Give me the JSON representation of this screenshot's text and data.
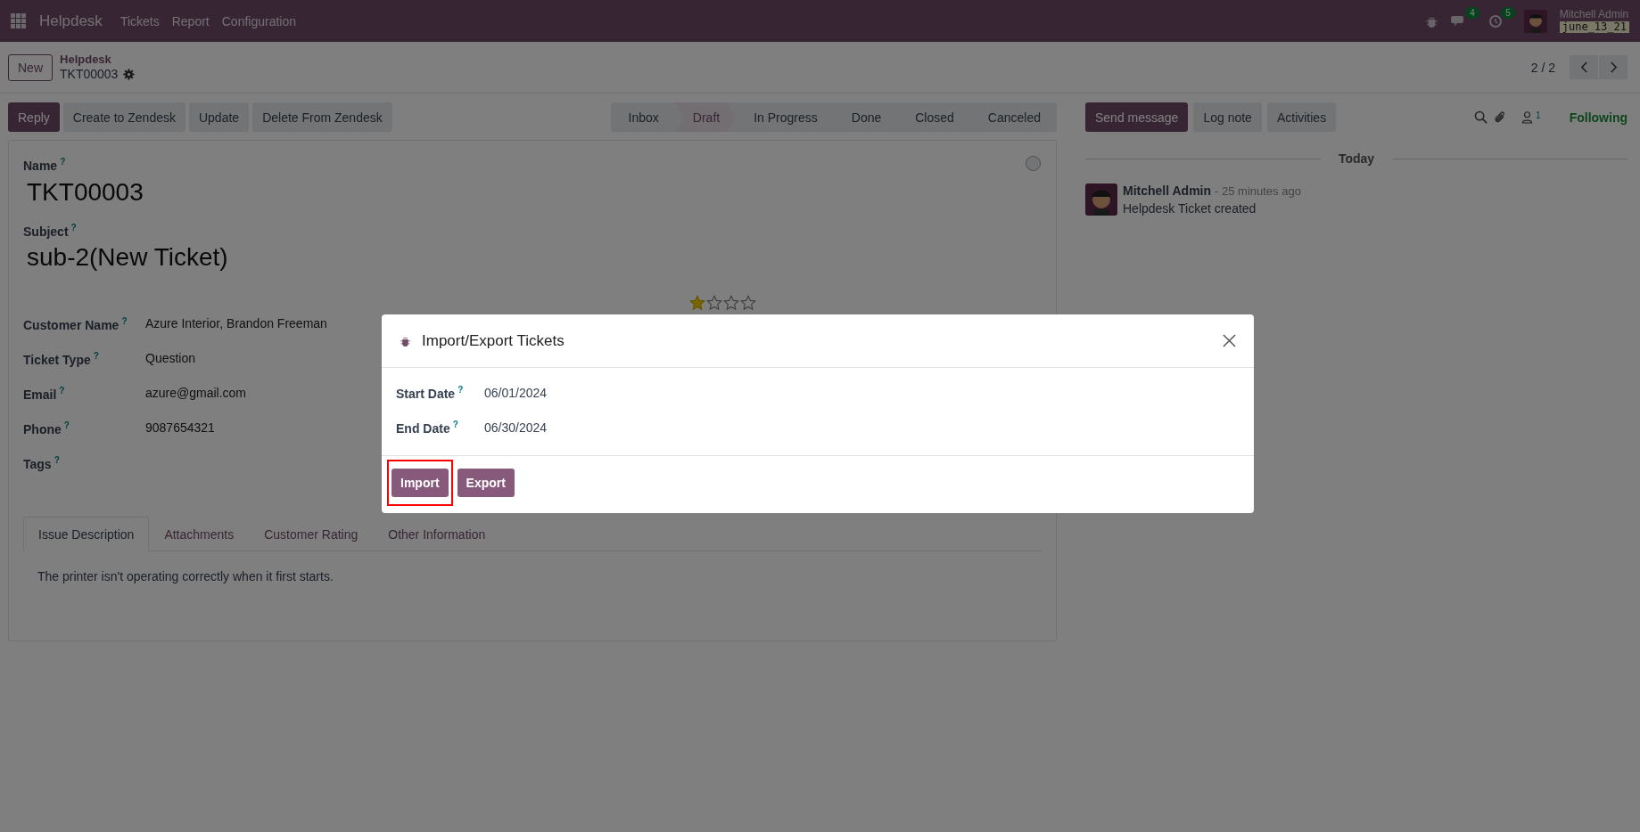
{
  "topbar": {
    "app_name": "Helpdesk",
    "menus": [
      "Tickets",
      "Report",
      "Configuration"
    ],
    "chat_count": "4",
    "activity_count": "5",
    "user_name": "Mitchell Admin",
    "database": "june_13_21"
  },
  "breadcrumb": {
    "new_button": "New",
    "parent": "Helpdesk",
    "record": "TKT00003"
  },
  "pager": {
    "text": "2 / 2"
  },
  "action_buttons": [
    {
      "label": "Reply",
      "kind": "primary"
    },
    {
      "label": "Create to Zendesk",
      "kind": "secondary"
    },
    {
      "label": "Update",
      "kind": "secondary"
    },
    {
      "label": "Delete From Zendesk",
      "kind": "secondary"
    }
  ],
  "stages": [
    {
      "label": "Inbox",
      "selected": false
    },
    {
      "label": "Draft",
      "selected": true
    },
    {
      "label": "In Progress",
      "selected": false
    },
    {
      "label": "Done",
      "selected": false
    },
    {
      "label": "Closed",
      "selected": false
    },
    {
      "label": "Canceled",
      "selected": false
    }
  ],
  "form": {
    "name": {
      "label": "Name",
      "help": "?",
      "value": "TKT00003"
    },
    "subject": {
      "label": "Subject",
      "help": "?",
      "value": "sub-2(New Ticket)"
    },
    "fields": [
      {
        "label": "Customer Name",
        "help": "?",
        "value": "Azure Interior, Brandon Freeman"
      },
      {
        "label": "Ticket Type",
        "help": "?",
        "value": "Question"
      },
      {
        "label": "Email",
        "help": "?",
        "value": "azure@gmail.com"
      },
      {
        "label": "Phone",
        "help": "?",
        "value": "9087654321"
      },
      {
        "label": "Tags",
        "help": "?"
      }
    ],
    "priority": {
      "stars": 1
    },
    "tabs": [
      {
        "label": "Issue Description",
        "selected": true
      },
      {
        "label": "Attachments",
        "selected": false
      },
      {
        "label": "Customer Rating",
        "selected": false
      },
      {
        "label": "Other Information",
        "selected": false
      }
    ],
    "description": "The printer isn't operating correctly when it first starts."
  },
  "chatter": {
    "buttons": [
      {
        "label": "Send message",
        "kind": "primary"
      },
      {
        "label": "Log note",
        "kind": "secondary"
      },
      {
        "label": "Activities",
        "kind": "secondary"
      }
    ],
    "follower_count": "1",
    "follow_status": "Following",
    "date_separator": "Today",
    "messages": [
      {
        "author": "Mitchell Admin",
        "time": "- 25 minutes ago",
        "body": "Helpdesk Ticket created"
      }
    ]
  },
  "dialog": {
    "title": "Import/Export Tickets",
    "fields": [
      {
        "label": "Start Date",
        "help": "?",
        "value": "06/01/2024"
      },
      {
        "label": "End Date",
        "help": "?",
        "value": "06/30/2024"
      }
    ],
    "buttons": [
      {
        "label": "Import",
        "highlighted": true
      },
      {
        "label": "Export",
        "highlighted": false
      }
    ]
  }
}
